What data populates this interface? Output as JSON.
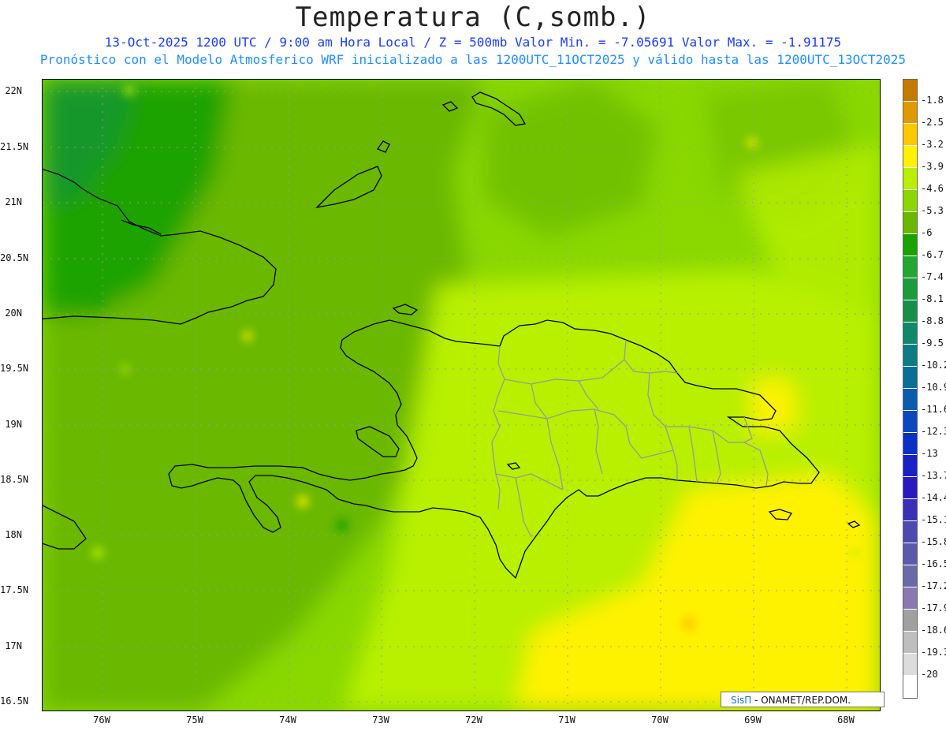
{
  "title": "Temperatura (C,somb.)",
  "subtitle_line1": "13-Oct-2025  1200 UTC / 9:00 am Hora Local / Z = 500mb  Valor Min. = -7.05691  Valor Max. = -1.91175",
  "subtitle_line2": "Pronóstico con el Modelo Atmosferico WRF inicializado a las 1200UTC_11OCT2025 y válido hasta las  1200UTC_13OCT2025",
  "map": {
    "lat_range": [
      16.42,
      22.1
    ],
    "lon_range": [
      -76.65,
      -67.65
    ],
    "lat_ticks": [
      "22N",
      "21.5N",
      "21N",
      "20.5N",
      "20N",
      "19.5N",
      "19N",
      "18.5N",
      "18N",
      "17.5N",
      "17N",
      "16.5N"
    ],
    "lon_ticks": [
      "76W",
      "75W",
      "74W",
      "73W",
      "72W",
      "71W",
      "70W",
      "69W",
      "68W"
    ],
    "grid": true
  },
  "colorbar": {
    "labels": [
      "-1.8",
      "-2.5",
      "-3.2",
      "-3.9",
      "-4.6",
      "-5.3",
      "-6",
      "-6.7",
      "-7.4",
      "-8.1",
      "-8.8",
      "-9.5",
      "-10.2",
      "-10.9",
      "-11.6",
      "-12.3",
      "-13",
      "-13.7",
      "-14.4",
      "-15.1",
      "-15.8",
      "-16.5",
      "-17.2",
      "-17.9",
      "-18.6",
      "-19.3",
      "-20"
    ],
    "colors": [
      "#c77a00",
      "#e09a00",
      "#ffc800",
      "#fff200",
      "#b8f000",
      "#8ad800",
      "#6ab800",
      "#1aa300",
      "#22a832",
      "#1a9c3c",
      "#14904a",
      "#10886a",
      "#0c7c84",
      "#0a6e98",
      "#0a5cb0",
      "#0a48c0",
      "#0a30c8",
      "#1a20c8",
      "#2a18c0",
      "#3a30b8",
      "#4a4ab0",
      "#5a5aa8",
      "#6a6aa8",
      "#8a78b0",
      "#a0a0a0",
      "#bebebe",
      "#dcdcdc",
      "#ffffff"
    ]
  },
  "credit": {
    "brand": "SisΠ",
    "text": "- ONAMET/REP.DOM."
  }
}
